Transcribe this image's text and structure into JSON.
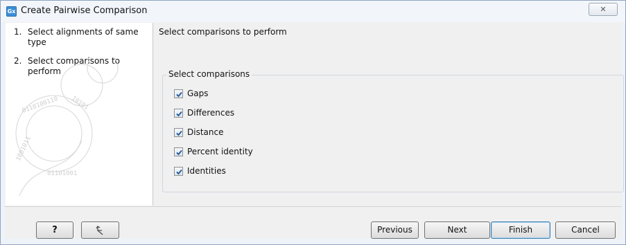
{
  "window": {
    "title": "Create Pairwise Comparison",
    "app_icon_text": "Gx",
    "close_glyph": "✕"
  },
  "steps": [
    {
      "number": "1.",
      "label": "Select alignments of same type"
    },
    {
      "number": "2.",
      "label": "Select comparisons to perform"
    }
  ],
  "panel": {
    "heading": "Select comparisons to perform",
    "group_title": "Select comparisons",
    "options": [
      {
        "label": "Gaps",
        "checked": true
      },
      {
        "label": "Differences",
        "checked": true
      },
      {
        "label": "Distance",
        "checked": true
      },
      {
        "label": "Percent identity",
        "checked": true
      },
      {
        "label": "Identities",
        "checked": true
      }
    ]
  },
  "footer": {
    "help_label": "?",
    "reset_icon": "reset-arrow-icon",
    "previous_label": "Previous",
    "next_label": "Next",
    "finish_label": "Finish",
    "cancel_label": "Cancel"
  },
  "colors": {
    "accent": "#3a8fd6",
    "check": "#2b5f9e"
  }
}
